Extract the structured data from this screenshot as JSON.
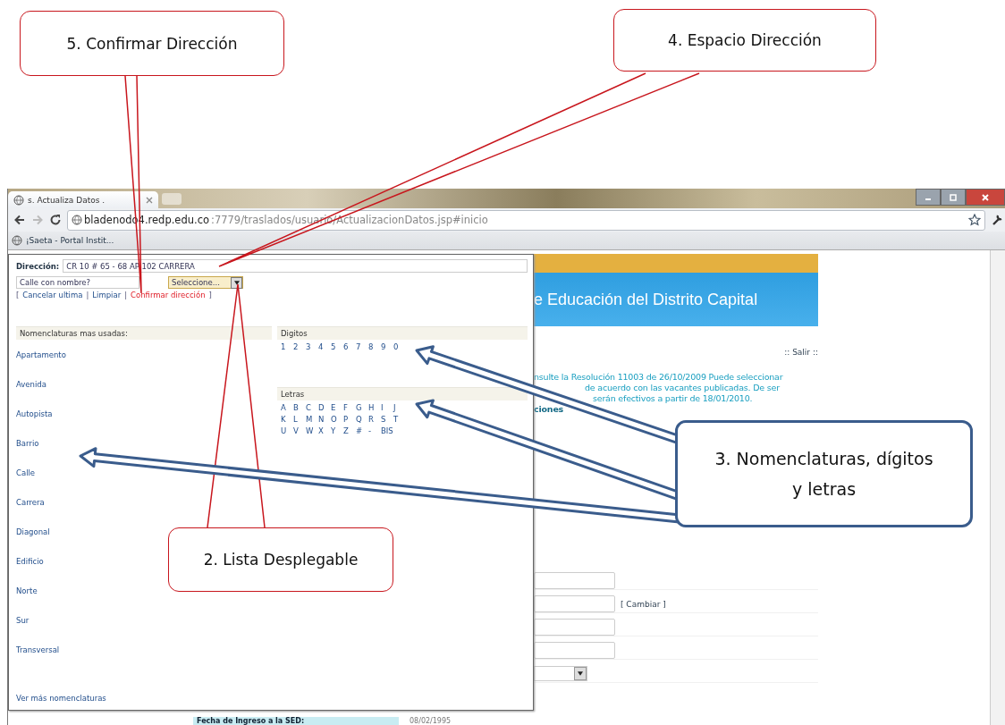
{
  "callouts": [
    {
      "kind": "red",
      "text": "5. Confirmar Dirección"
    },
    {
      "kind": "red",
      "text": "4. Espacio Dirección"
    },
    {
      "kind": "blue",
      "text": "3. Nomenclaturas, dígitos y letras"
    },
    {
      "kind": "red",
      "text": "2. Lista Desplegable"
    }
  ],
  "browser": {
    "tab_title": "s. Actualiza Datos .",
    "url_host": "bladenodo4.redp.edu.co",
    "url_path": ":7779/traslados/usuario/ActualizacionDatos.jsp#inicio",
    "bookmark": "¡Saeta - Portal Instit..."
  },
  "popup": {
    "address_label": "Dirección:",
    "address_value": "CR 10 # 65 - 68 AP 102 CARRERA",
    "street_placeholder": "Calle con nombre?",
    "select_value": "Seleccione...",
    "actions": [
      {
        "kind": "punct",
        "text": "["
      },
      {
        "kind": "link",
        "text": "Cancelar ultima"
      },
      {
        "kind": "punct",
        "text": "|"
      },
      {
        "kind": "link",
        "text": "Limpiar"
      },
      {
        "kind": "punct",
        "text": "|"
      },
      {
        "kind": "confirm",
        "text": "Confirmar dirección"
      },
      {
        "kind": "punct",
        "text": "]"
      }
    ],
    "nomenclatures_title": "Nomenclaturas mas usadas:",
    "nomenclatures": [
      "Apartamento",
      "Avenida",
      "Autopista",
      "Barrio",
      "Calle",
      "Carrera",
      "Diagonal",
      "Edificio",
      "Norte",
      "Sur",
      "Transversal"
    ],
    "more_link": "Ver más nomenclaturas",
    "digits_title": "Digitos",
    "digits": [
      "1",
      "2",
      "3",
      "4",
      "5",
      "6",
      "7",
      "8",
      "9",
      "0"
    ],
    "letters_title": "Letras",
    "letter_rows": [
      [
        "A",
        "B",
        "C",
        "D",
        "E",
        "F",
        "G",
        "H",
        "I",
        "J"
      ],
      [
        "K",
        "L",
        "M",
        "N",
        "O",
        "P",
        "Q",
        "R",
        "S",
        "T"
      ],
      [
        "U",
        "V",
        "W",
        "X",
        "Y",
        "Z",
        "#",
        "-",
        "BIS"
      ]
    ]
  },
  "page": {
    "banner_text": "e Educación del Distrito Capital",
    "exit_link": ":: Salir ::",
    "notice_lines": [
      "nsulte la Resolución 11003 de 26/10/2009 Puede seleccionar",
      "de acuerdo con las vacantes publicadas. De ser",
      "serán efectivos a partir de 18/01/2010.",
      "ciones"
    ],
    "change_link": "[ Cambiar ]",
    "bottom_label": "Fecha de Ingreso a la SED:",
    "bottom_value": "08/02/1995"
  }
}
